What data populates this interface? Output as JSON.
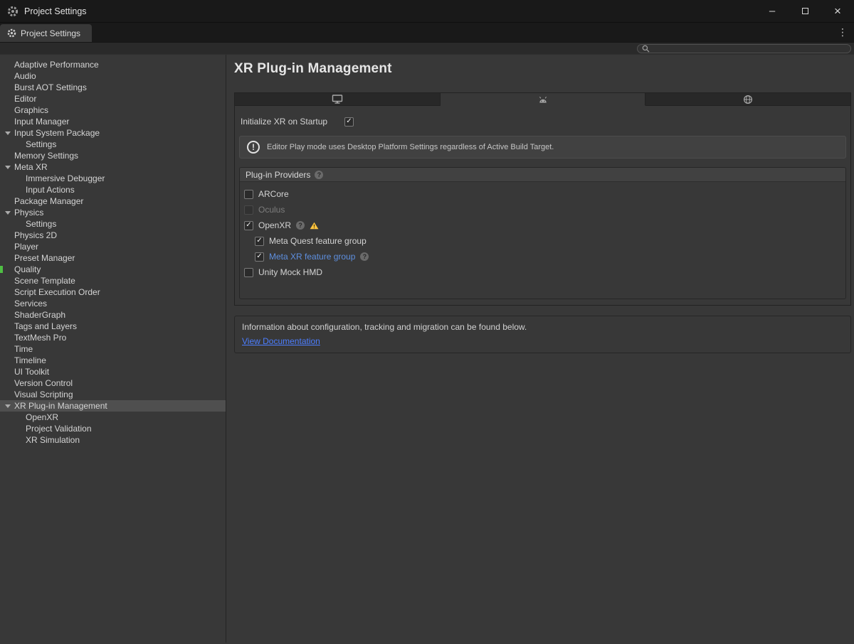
{
  "colors": {
    "link": "#4C7EFF",
    "selected_row": "#4F4F4F",
    "warning": "#FFC541",
    "quality_marker": "#4FBF44",
    "panel_bg": "#383838",
    "titlebar_bg": "#191919"
  },
  "icons": {
    "titlebar": "settings-gear-icon",
    "tab": "gear-icon",
    "search": "search-icon",
    "kebab": "kebab-menu-icon",
    "minimize": "minimize-icon",
    "maximize": "maximize-icon",
    "close": "close-icon",
    "foldout": "foldout-arrow-icon",
    "help": "help-icon",
    "warning": "warning-icon",
    "info": "info-icon",
    "platforms": [
      "desktop-platform-icon",
      "android-platform-icon",
      "web-platform-icon"
    ]
  },
  "window": {
    "title": "Project Settings",
    "controls": {
      "minimize": "–",
      "close": "×"
    }
  },
  "tabbar": {
    "tab_label": "Project Settings",
    "kebab": "⋮"
  },
  "toolbar": {
    "search_placeholder": ""
  },
  "sidebar": {
    "items": [
      {
        "label": "Adaptive Performance",
        "indent": 0
      },
      {
        "label": "Audio",
        "indent": 0
      },
      {
        "label": "Burst AOT Settings",
        "indent": 0
      },
      {
        "label": "Editor",
        "indent": 0
      },
      {
        "label": "Graphics",
        "indent": 0
      },
      {
        "label": "Input Manager",
        "indent": 0
      },
      {
        "label": "Input System Package",
        "indent": 0,
        "foldout": true
      },
      {
        "label": "Settings",
        "indent": 1
      },
      {
        "label": "Memory Settings",
        "indent": 0
      },
      {
        "label": "Meta XR",
        "indent": 0,
        "foldout": true
      },
      {
        "label": "Immersive Debugger",
        "indent": 1
      },
      {
        "label": "Input Actions",
        "indent": 1
      },
      {
        "label": "Package Manager",
        "indent": 0
      },
      {
        "label": "Physics",
        "indent": 0,
        "foldout": true
      },
      {
        "label": "Settings",
        "indent": 1
      },
      {
        "label": "Physics 2D",
        "indent": 0
      },
      {
        "label": "Player",
        "indent": 0
      },
      {
        "label": "Preset Manager",
        "indent": 0
      },
      {
        "label": "Quality",
        "indent": 0,
        "marker": true
      },
      {
        "label": "Scene Template",
        "indent": 0
      },
      {
        "label": "Script Execution Order",
        "indent": 0
      },
      {
        "label": "Services",
        "indent": 0
      },
      {
        "label": "ShaderGraph",
        "indent": 0
      },
      {
        "label": "Tags and Layers",
        "indent": 0
      },
      {
        "label": "TextMesh Pro",
        "indent": 0
      },
      {
        "label": "Time",
        "indent": 0
      },
      {
        "label": "Timeline",
        "indent": 0
      },
      {
        "label": "UI Toolkit",
        "indent": 0
      },
      {
        "label": "Version Control",
        "indent": 0
      },
      {
        "label": "Visual Scripting",
        "indent": 0
      },
      {
        "label": "XR Plug-in Management",
        "indent": 0,
        "foldout": true,
        "selected": true
      },
      {
        "label": "OpenXR",
        "indent": 1
      },
      {
        "label": "Project Validation",
        "indent": 1
      },
      {
        "label": "XR Simulation",
        "indent": 1
      }
    ]
  },
  "main": {
    "title": "XR Plug-in Management",
    "platform_tabs": [
      {
        "icon": "desktop-platform-icon",
        "selected": false
      },
      {
        "icon": "android-platform-icon",
        "selected": true
      },
      {
        "icon": "web-platform-icon",
        "selected": false
      }
    ],
    "init_label": "Initialize XR on Startup",
    "init_checked": true,
    "help_text": "Editor Play mode uses Desktop Platform Settings regardless of Active Build Target.",
    "providers": {
      "header": "Plug-in Providers",
      "header_help": true,
      "items": [
        {
          "label": "ARCore",
          "checked": false,
          "indent": 0
        },
        {
          "label": "Oculus",
          "checked": false,
          "indent": 0,
          "disabled": true
        },
        {
          "label": "OpenXR",
          "checked": true,
          "indent": 0,
          "help": true,
          "warning": true
        },
        {
          "label": "Meta Quest feature group",
          "checked": true,
          "indent": 1
        },
        {
          "label": "Meta XR feature group",
          "checked": true,
          "indent": 1,
          "blue": true,
          "help": true
        },
        {
          "label": "Unity Mock HMD",
          "checked": false,
          "indent": 0
        }
      ]
    },
    "info": {
      "text": "Information about configuration, tracking and migration can be found below.",
      "link_label": "View Documentation"
    }
  }
}
